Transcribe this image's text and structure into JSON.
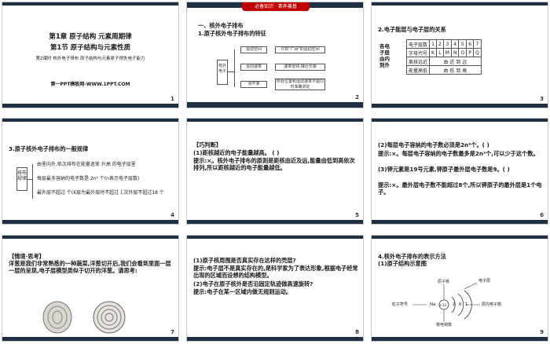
{
  "slides": {
    "s1": {
      "chapter": "第1章    原子结构    元素周期律",
      "section": "第1节    原子结构与元素性质",
      "lesson": "第2课时  核外电子排布  原子结构与元素原子得失电子能力",
      "footer": "第一PPT模板网-WWW.1PPT.COM",
      "number": "1"
    },
    "s2": {
      "banner": "必备知识 · 素养奠基",
      "h1": "一、核外电子排布",
      "h2": "1.原子核外电子排布的特征",
      "left_box": "核外电子",
      "b1": "运动空间",
      "b2": "运动速率",
      "b3": "测不准",
      "r1": "只有\"广阔\"的运动空间",
      "r2": "速率很快,接近光速",
      "r3": "所处位置和运动速率不能同时准确测定",
      "number": "2"
    },
    "s3": {
      "title": "2.电子能层与电子层的关系",
      "side_label": "各电子层由内到外",
      "rows": [
        {
          "head": "电子层数",
          "cells": [
            "1",
            "2",
            "3",
            "4",
            "5",
            "6",
            "7"
          ]
        },
        {
          "head": "字母代号",
          "cells": [
            "K",
            "L",
            "M",
            "N",
            "O",
            "P",
            "Q"
          ]
        },
        {
          "head": "离核远近",
          "span": "由 近 到 远"
        },
        {
          "head": "能量高低",
          "span": "由 低 到 高"
        }
      ],
      "number": "3"
    },
    "s4": {
      "title": "3.原子核外电子排布的一般规律",
      "side": "排布规律",
      "r1": "由里向外,依次排布在能量逐渐 升高 的电子层里",
      "r2": "每层最多容纳的电子数是 2n² 个(n表示电子层数)",
      "r3": "最外层不超过   个(K层为最外层时不超过   ),次外层不超过18 个",
      "number": "4"
    },
    "s5": {
      "tag": "【巧判断】",
      "q1": "(1)距核越近的电子能量越高。         (    )",
      "a1": "提示:×。核外电子排布的原则是距核由近及远,能量由低到高依次排列,所以距核越近的电子能量越低。",
      "number": "5"
    },
    "s6": {
      "q2": "(2)每层电子容纳的电子数必须是2n²个。(    )",
      "a2": "提示:×。每层电子容纳的电子数最多是2n²个,可以少于这个数。",
      "q3": "(3)钾元素是19号元素,钾原子最外层电子数是9。(    )",
      "a3": "提示:×。最外层电子数不能超过8个,所以钾原子的最外层是1个电子。",
      "number": "6"
    },
    "s7": {
      "tag": "【情境·思考】",
      "body": "洋葱是我们非常熟悉的一种蔬菜,洋葱切开后,我们会看到里面一层一层的呈现,电子层模型类似于切开的洋葱。请思考:",
      "number": "7"
    },
    "s8": {
      "q1": "(1)原子核周围是否真实存在这样的壳层?",
      "a1": "提示:电子层不是真实存在的,是科学家为了表达形象,根据电子经常出现的区域而设想的结构模型。",
      "q2": "(2)电子在原子核外是否沿固定轨迹做高速旋转?",
      "a2": "提示:电子在某一区域内做无规则运动。",
      "number": "8"
    },
    "s9": {
      "h1": "4.核外电子排布的表示方法",
      "h2": "(1)原子结构示意图",
      "l_nucleus": "原子核",
      "l_layer": "电子层",
      "l_count": "层内电子数",
      "l_charge": "粒子符号",
      "l_nuc_charge": "核电荷数",
      "symbol": "Na",
      "core": "+11",
      "e1": "2",
      "e2": "8",
      "e3": "1",
      "number": "9"
    }
  },
  "colors": {
    "title_blue": "#1f3f8f",
    "accent_red": "#c00000",
    "bar_navy": "#1f2f44"
  }
}
